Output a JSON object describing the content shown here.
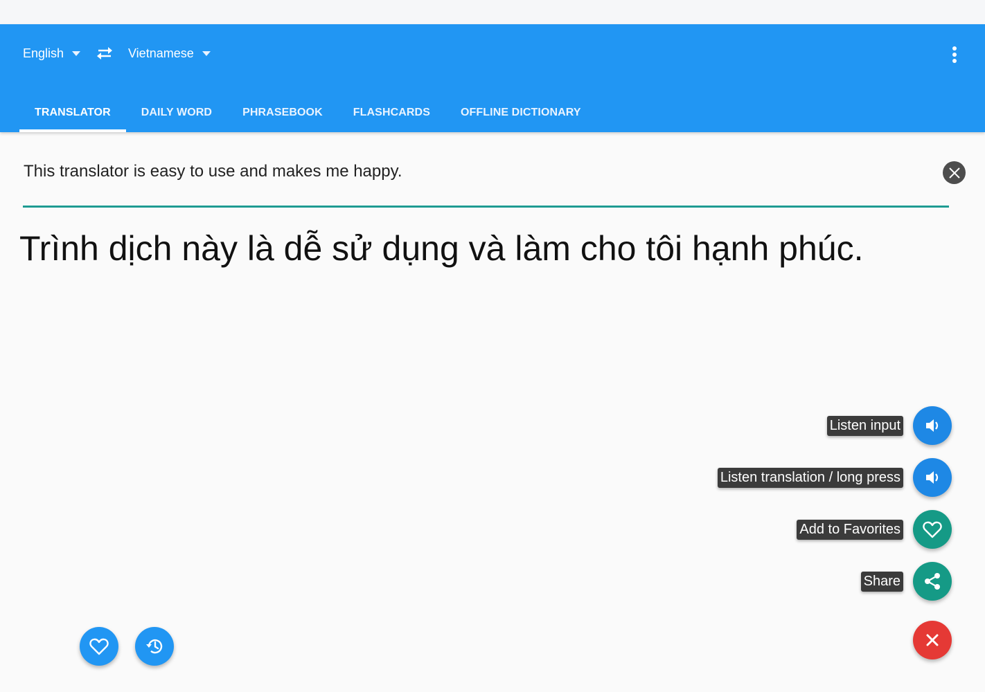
{
  "header": {
    "source_language": "English",
    "target_language": "Vietnamese",
    "swap_icon": "swap-arrows-icon",
    "menu_icon": "more-vert-icon"
  },
  "tabs": [
    {
      "label": "TRANSLATOR",
      "active": true
    },
    {
      "label": "DAILY WORD",
      "active": false
    },
    {
      "label": "PHRASEBOOK",
      "active": false
    },
    {
      "label": "FLASHCARDS",
      "active": false
    },
    {
      "label": "OFFLINE DICTIONARY",
      "active": false
    }
  ],
  "translator": {
    "input_text": "This translator is easy to use and makes me happy.",
    "output_text": "Trình dịch này là dễ sử dụng và làm cho tôi hạnh phúc."
  },
  "actions": {
    "listen_input": "Listen input",
    "listen_translation": "Listen translation / long press",
    "add_favorites": "Add to Favorites",
    "share": "Share"
  },
  "colors": {
    "appbar": "#2196f3",
    "accent_underline": "#1e9b92",
    "fab_blue": "#1e88e5",
    "fab_teal": "#159a86",
    "fab_close": "#e53935"
  }
}
